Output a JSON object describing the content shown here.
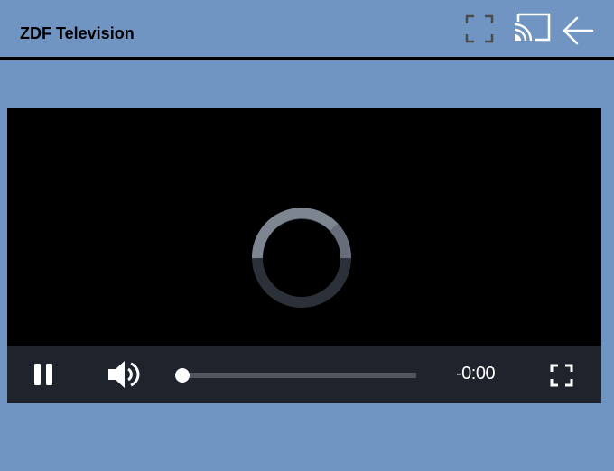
{
  "header": {
    "title": "ZDF Television",
    "icons": [
      "fullscreen-icon",
      "cast-icon",
      "back-arrow-icon"
    ]
  },
  "player": {
    "state": "loading",
    "loading_indicator": "spinner-icon",
    "controls": {
      "play_pause_icon": "pause-icon",
      "volume_icon": "volume-icon",
      "time_remaining": "-0:00",
      "progress": 0,
      "fullscreen_icon": "fullscreen-icon"
    }
  },
  "colors": {
    "page_background": "#7095c2",
    "video_background": "#000000",
    "controls_background": "#1f232b",
    "progress_track": "#50555e",
    "foreground": "#ffffff"
  }
}
